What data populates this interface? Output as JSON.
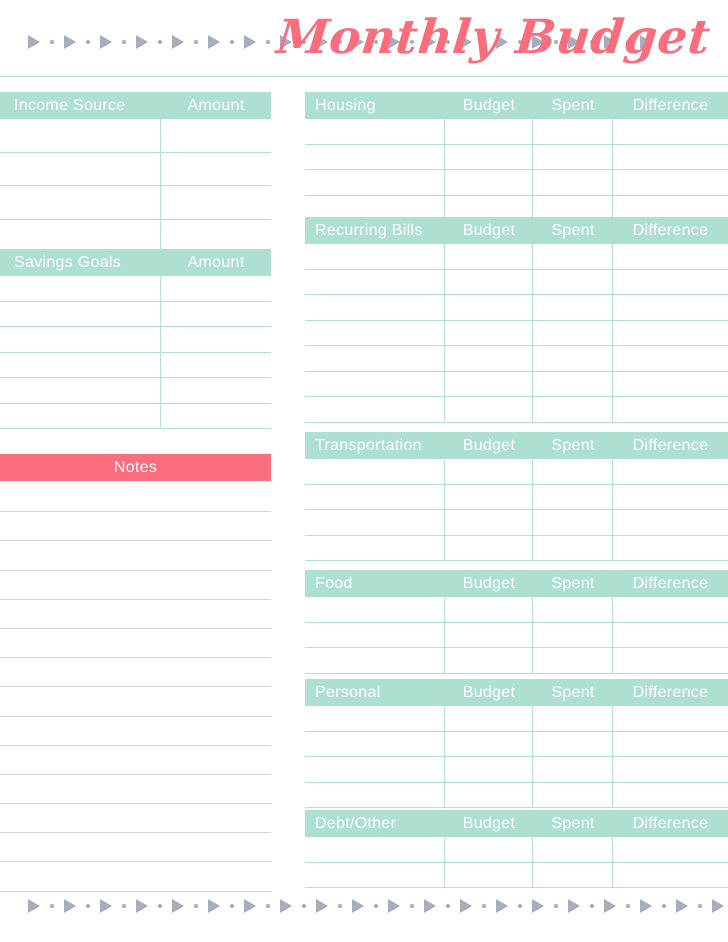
{
  "page": {
    "title": "Monthly Budget",
    "title_color": "#f96d7c",
    "accent_mint": "#aedfd3",
    "accent_coral": "#f96d7c",
    "border_icon": "triangle-right-icon",
    "border_dot_icon": "dot-icon",
    "border_color": "#a8adbd",
    "background": "#ffffff"
  },
  "left_column": {
    "income": {
      "headers": [
        "Income Source",
        "Amount"
      ],
      "row_count": 4,
      "rows": [
        [
          "",
          ""
        ],
        [
          "",
          ""
        ],
        [
          "",
          ""
        ],
        [
          "",
          ""
        ]
      ]
    },
    "savings": {
      "headers": [
        "Savings Goals",
        "Amount"
      ],
      "row_count": 6,
      "rows": [
        [
          "",
          ""
        ],
        [
          "",
          ""
        ],
        [
          "",
          ""
        ],
        [
          "",
          ""
        ],
        [
          "",
          ""
        ],
        [
          "",
          ""
        ]
      ]
    },
    "notes": {
      "header": "Notes",
      "line_count": 14,
      "lines": [
        "",
        "",
        "",
        "",
        "",
        "",
        "",
        "",
        "",
        "",
        "",
        "",
        "",
        ""
      ]
    }
  },
  "right_column": {
    "common_headers": [
      "Budget",
      "Spent",
      "Difference"
    ],
    "sections": [
      {
        "name": "Housing",
        "headers": [
          "Housing",
          "Budget",
          "Spent",
          "Difference"
        ],
        "row_count": 4,
        "rows": [
          [
            "",
            "",
            "",
            ""
          ],
          [
            "",
            "",
            "",
            ""
          ],
          [
            "",
            "",
            "",
            ""
          ],
          [
            "",
            "",
            "",
            ""
          ]
        ]
      },
      {
        "name": "Recurring Bills",
        "headers": [
          "Recurring Bills",
          "Budget",
          "Spent",
          "Difference"
        ],
        "row_count": 7,
        "rows": [
          [
            "",
            "",
            "",
            ""
          ],
          [
            "",
            "",
            "",
            ""
          ],
          [
            "",
            "",
            "",
            ""
          ],
          [
            "",
            "",
            "",
            ""
          ],
          [
            "",
            "",
            "",
            ""
          ],
          [
            "",
            "",
            "",
            ""
          ],
          [
            "",
            "",
            "",
            ""
          ]
        ]
      },
      {
        "name": "Transportation",
        "headers": [
          "Transportation",
          "Budget",
          "Spent",
          "Difference"
        ],
        "row_count": 4,
        "rows": [
          [
            "",
            "",
            "",
            ""
          ],
          [
            "",
            "",
            "",
            ""
          ],
          [
            "",
            "",
            "",
            ""
          ],
          [
            "",
            "",
            "",
            ""
          ]
        ]
      },
      {
        "name": "Food",
        "headers": [
          "Food",
          "Budget",
          "Spent",
          "Difference"
        ],
        "row_count": 3,
        "rows": [
          [
            "",
            "",
            "",
            ""
          ],
          [
            "",
            "",
            "",
            ""
          ],
          [
            "",
            "",
            "",
            ""
          ]
        ]
      },
      {
        "name": "Personal",
        "headers": [
          "Personal",
          "Budget",
          "Spent",
          "Difference"
        ],
        "row_count": 4,
        "rows": [
          [
            "",
            "",
            "",
            ""
          ],
          [
            "",
            "",
            "",
            ""
          ],
          [
            "",
            "",
            "",
            ""
          ],
          [
            "",
            "",
            "",
            ""
          ]
        ]
      },
      {
        "name": "Debt/Other",
        "headers": [
          "Debt/Other",
          "Budget",
          "Spent",
          "Difference"
        ],
        "row_count": 2,
        "rows": [
          [
            "",
            "",
            "",
            ""
          ],
          [
            "",
            "",
            "",
            ""
          ]
        ]
      }
    ]
  }
}
